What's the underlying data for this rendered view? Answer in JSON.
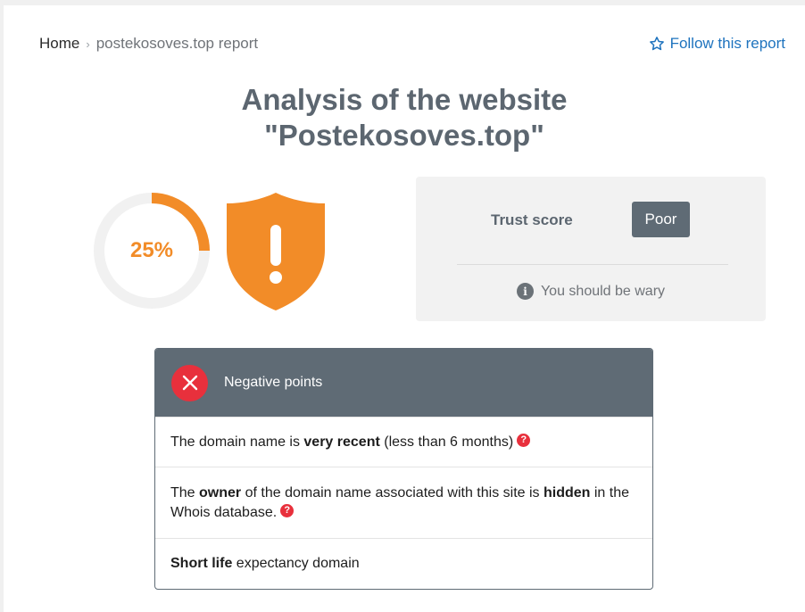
{
  "breadcrumb": {
    "home": "Home",
    "separator": "›",
    "current": "postekosoves.top report"
  },
  "follow": {
    "label": "Follow this report",
    "icon": "star-outline-icon"
  },
  "title": {
    "line1": "Analysis of the website",
    "line2": "\"Postekosoves.top\""
  },
  "score": {
    "percent_text": "25%",
    "fraction": 0.25,
    "color": "#f28c28",
    "shield_icon": "shield-exclamation-icon"
  },
  "trust": {
    "label": "Trust score",
    "badge": "Poor",
    "note": "You should be wary",
    "info_glyph": "i"
  },
  "negative": {
    "title": "Negative points",
    "items": [
      {
        "pre": "The domain name is ",
        "bold1": "very recent",
        "post": " (less than 6 months)",
        "help": "?"
      },
      {
        "pre": "The ",
        "bold1": "owner",
        "mid": " of the domain name associated with this site is ",
        "bold2": "hidden",
        "post": " in the Whois database.",
        "help": "?"
      },
      {
        "bold1": "Short life",
        "post": " expectancy domain"
      }
    ]
  },
  "colors": {
    "accent_orange": "#f28c28",
    "danger_red": "#e8303c",
    "slate": "#5f6b75",
    "link_blue": "#1e73be"
  }
}
